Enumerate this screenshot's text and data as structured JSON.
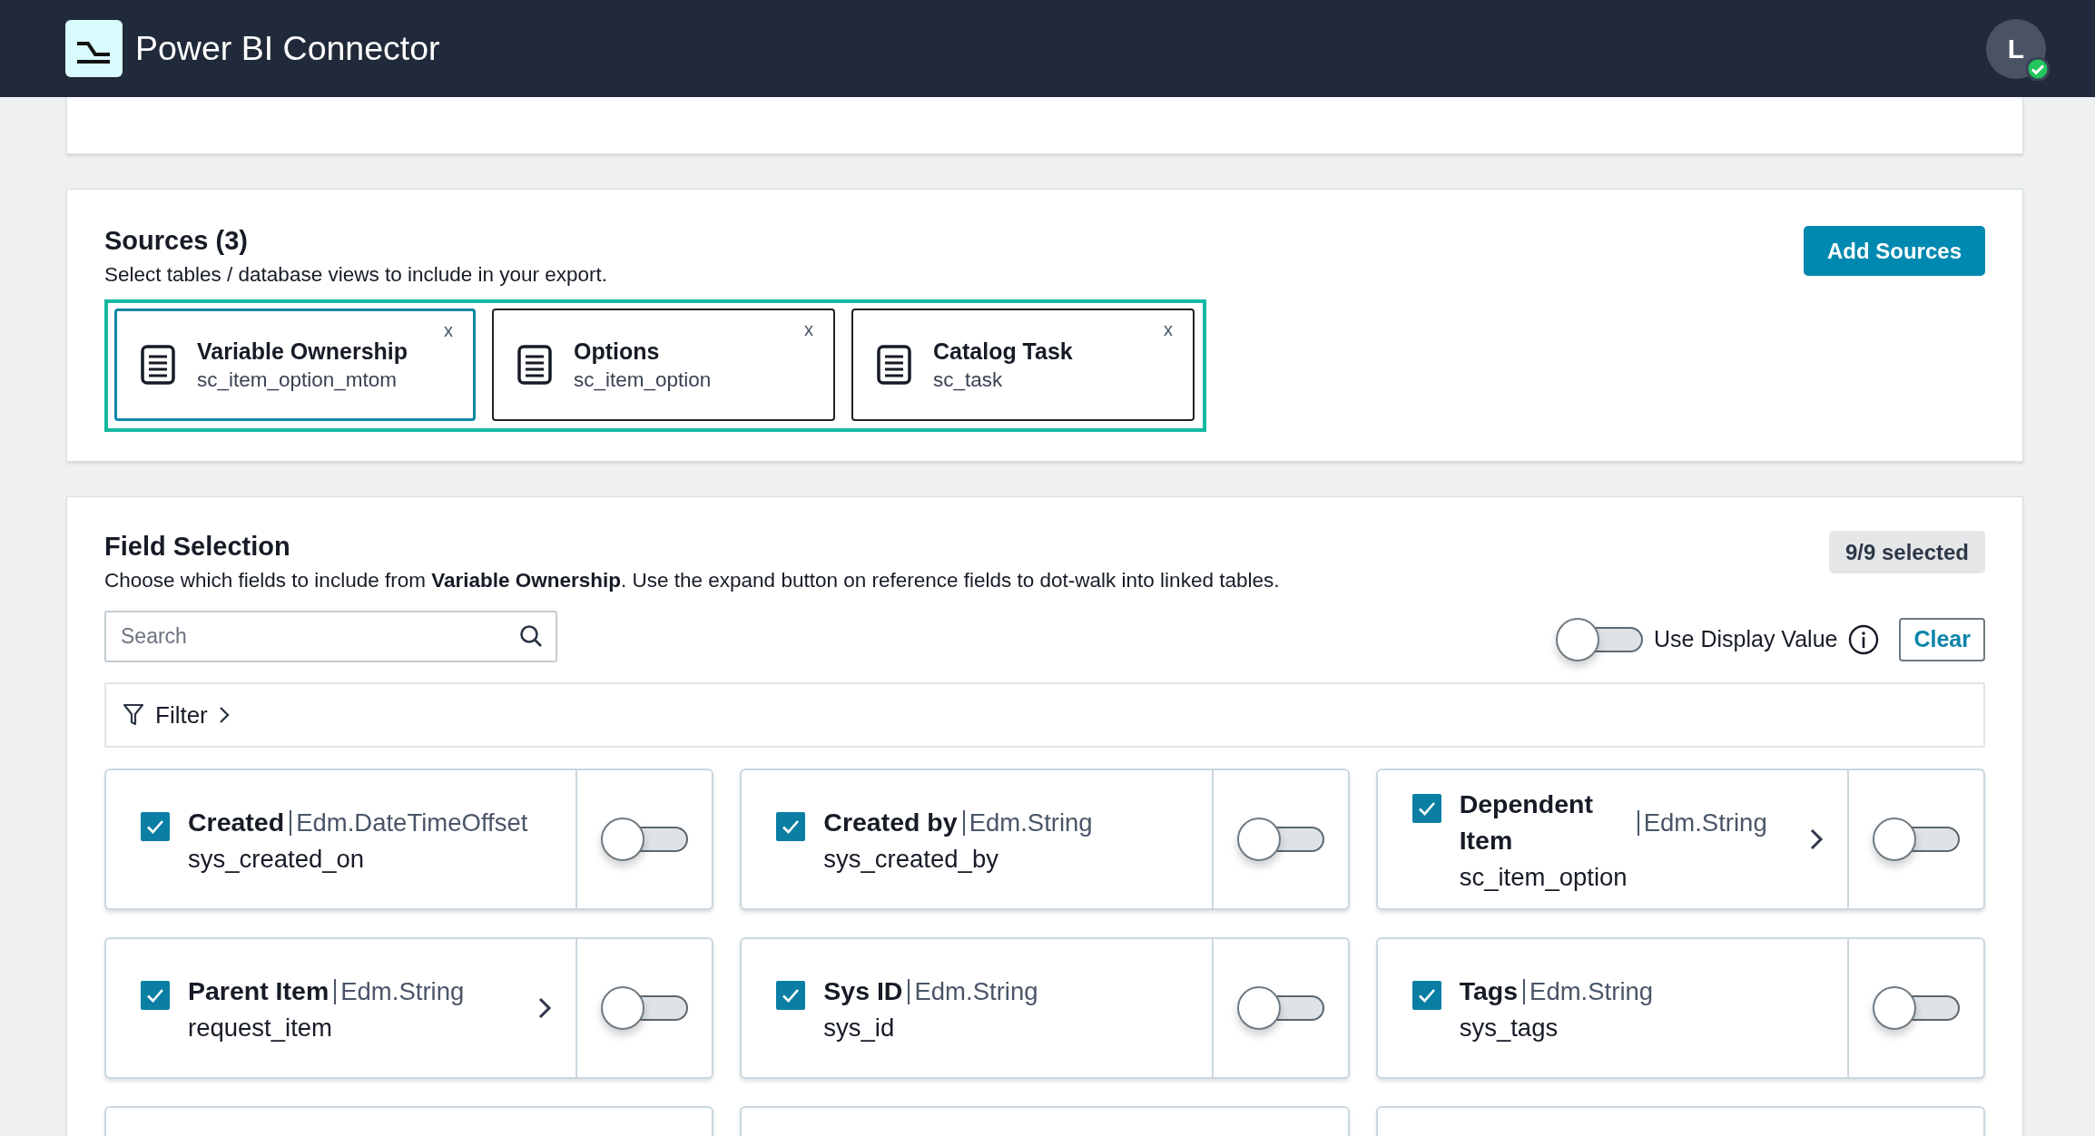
{
  "header": {
    "title": "Power BI Connector",
    "avatar": "L",
    "verified": true
  },
  "sources": {
    "title": "Sources (3)",
    "subtitle": "Select tables / database views to include in your export.",
    "button": "Add Sources",
    "items": [
      {
        "name": "Variable Ownership",
        "table": "sc_item_option_mtom",
        "remove": "x",
        "selected": true
      },
      {
        "name": "Options",
        "table": "sc_item_option",
        "remove": "x",
        "selected": false
      },
      {
        "name": "Catalog Task",
        "table": "sc_task",
        "remove": "x",
        "selected": false
      }
    ]
  },
  "field_selection": {
    "title": "Field Selection",
    "description": "Choose which fields to include from **Variable Ownership**. Use the expand button on reference fields to dot-walk into linked tables.",
    "count": "9/9 selected",
    "search": {
      "placeholder": "Search"
    },
    "display_value": {
      "label": "Use Display Value",
      "on": false
    },
    "clear": "Clear",
    "filter": {
      "label": "Filter"
    },
    "fields": [
      {
        "label": "Created",
        "type": "Edm.DateTimeOffset",
        "name": "sys_created_on",
        "checked": true,
        "expandable": false,
        "on": false
      },
      {
        "label": "Created by",
        "type": "Edm.String",
        "name": "sys_created_by",
        "checked": true,
        "expandable": false,
        "on": false
      },
      {
        "label": "Dependent Item",
        "type": "Edm.String",
        "name": "sc_item_option",
        "checked": true,
        "expandable": true,
        "on": false
      },
      {
        "label": "Parent Item",
        "type": "Edm.String",
        "name": "request_item",
        "checked": true,
        "expandable": true,
        "on": false
      },
      {
        "label": "Sys ID",
        "type": "Edm.String",
        "name": "sys_id",
        "checked": true,
        "expandable": false,
        "on": false
      },
      {
        "label": "Tags",
        "type": "Edm.String",
        "name": "sys_tags",
        "checked": true,
        "expandable": false,
        "on": false
      }
    ]
  }
}
